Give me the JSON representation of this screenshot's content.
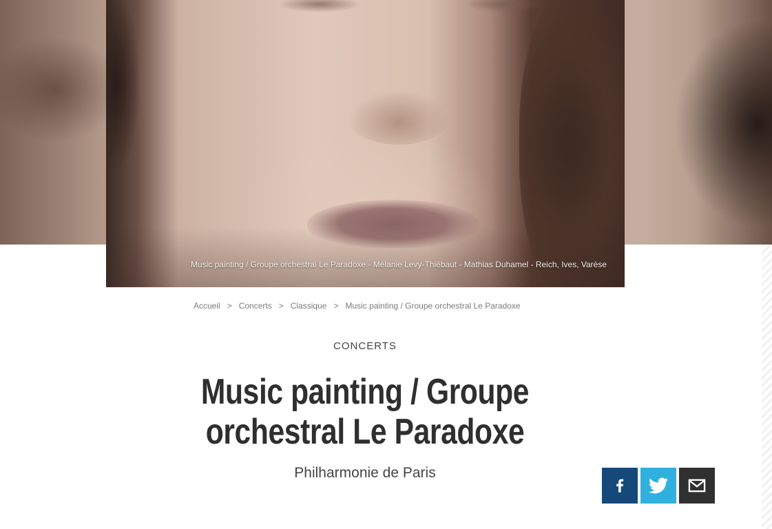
{
  "hero": {
    "caption": "Music painting / Groupe orchestral Le Paradoxe - Mélanie Levy-Thiébaut - Mathias Duhamel - Reich, Ives, Varèse"
  },
  "breadcrumb": {
    "items": [
      "Accueil",
      "Concerts",
      "Classique",
      "Music painting / Groupe orchestral Le Paradoxe"
    ],
    "separator": ">"
  },
  "category": "CONCERTS",
  "title": {
    "line1": "Music painting / Groupe",
    "line2": "orchestral Le Paradoxe"
  },
  "venue": "Philharmonie de Paris",
  "share": {
    "facebook_icon": "facebook-icon",
    "twitter_icon": "twitter-icon",
    "email_icon": "email-icon",
    "colors": {
      "facebook": "#15497a",
      "twitter": "#2fb0df",
      "email": "#303030"
    }
  }
}
